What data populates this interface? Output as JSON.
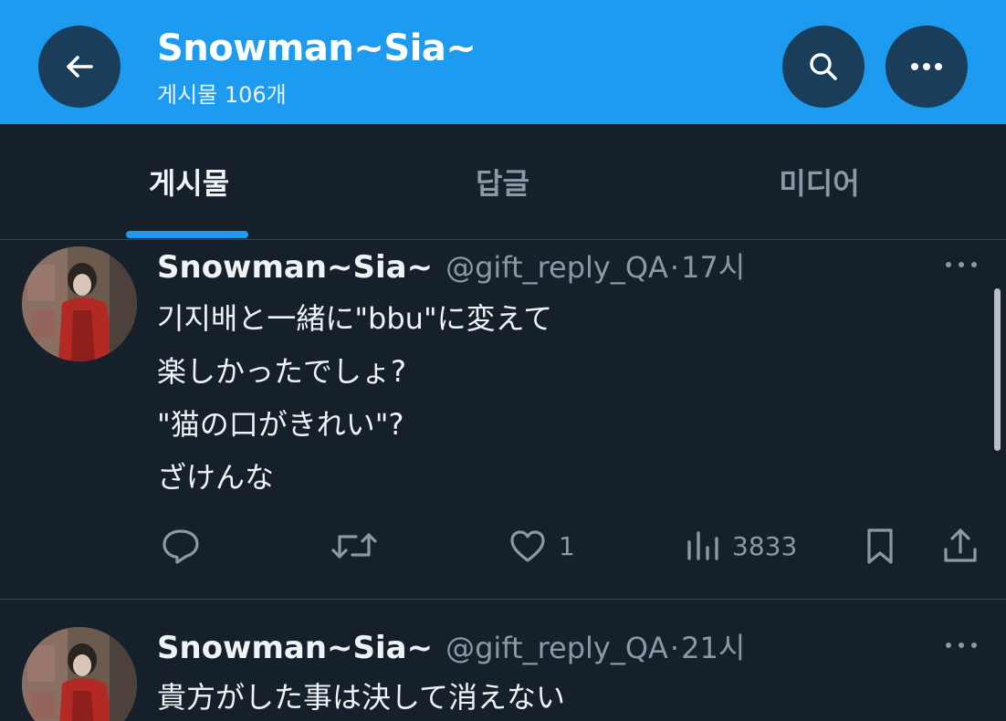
{
  "header": {
    "title": "Snowman~Sia~",
    "subtitle": "게시물 106개",
    "back_icon": "arrow-left-icon",
    "search_icon": "search-icon",
    "more_icon": "more-horizontal-icon",
    "background": "#1d9bf0"
  },
  "tabs": [
    {
      "label": "게시물",
      "active": true
    },
    {
      "label": "답글",
      "active": false
    },
    {
      "label": "미디어",
      "active": false
    }
  ],
  "tweets": [
    {
      "name": "Snowman~Sia~",
      "handle": "@gift_reply_QA",
      "separator": "·",
      "time": "17시",
      "lines": [
        "기지배と一緒に\"bbu\"に変えて",
        "楽しかったでしょ?",
        "\"猫の口がきれい\"?",
        "ざけんな"
      ],
      "actions": {
        "reply_count": "",
        "retweet_count": "",
        "like_count": "1",
        "view_count": "3833"
      }
    },
    {
      "name": "Snowman~Sia~",
      "handle": "@gift_reply_QA",
      "separator": "·",
      "time": "21시",
      "lines": [
        "貴方がした事は決して消えない"
      ]
    }
  ],
  "colors": {
    "background": "#15202b",
    "accent": "#1d9bf0",
    "muted_text": "#8b98a5",
    "divider": "#38444d"
  }
}
